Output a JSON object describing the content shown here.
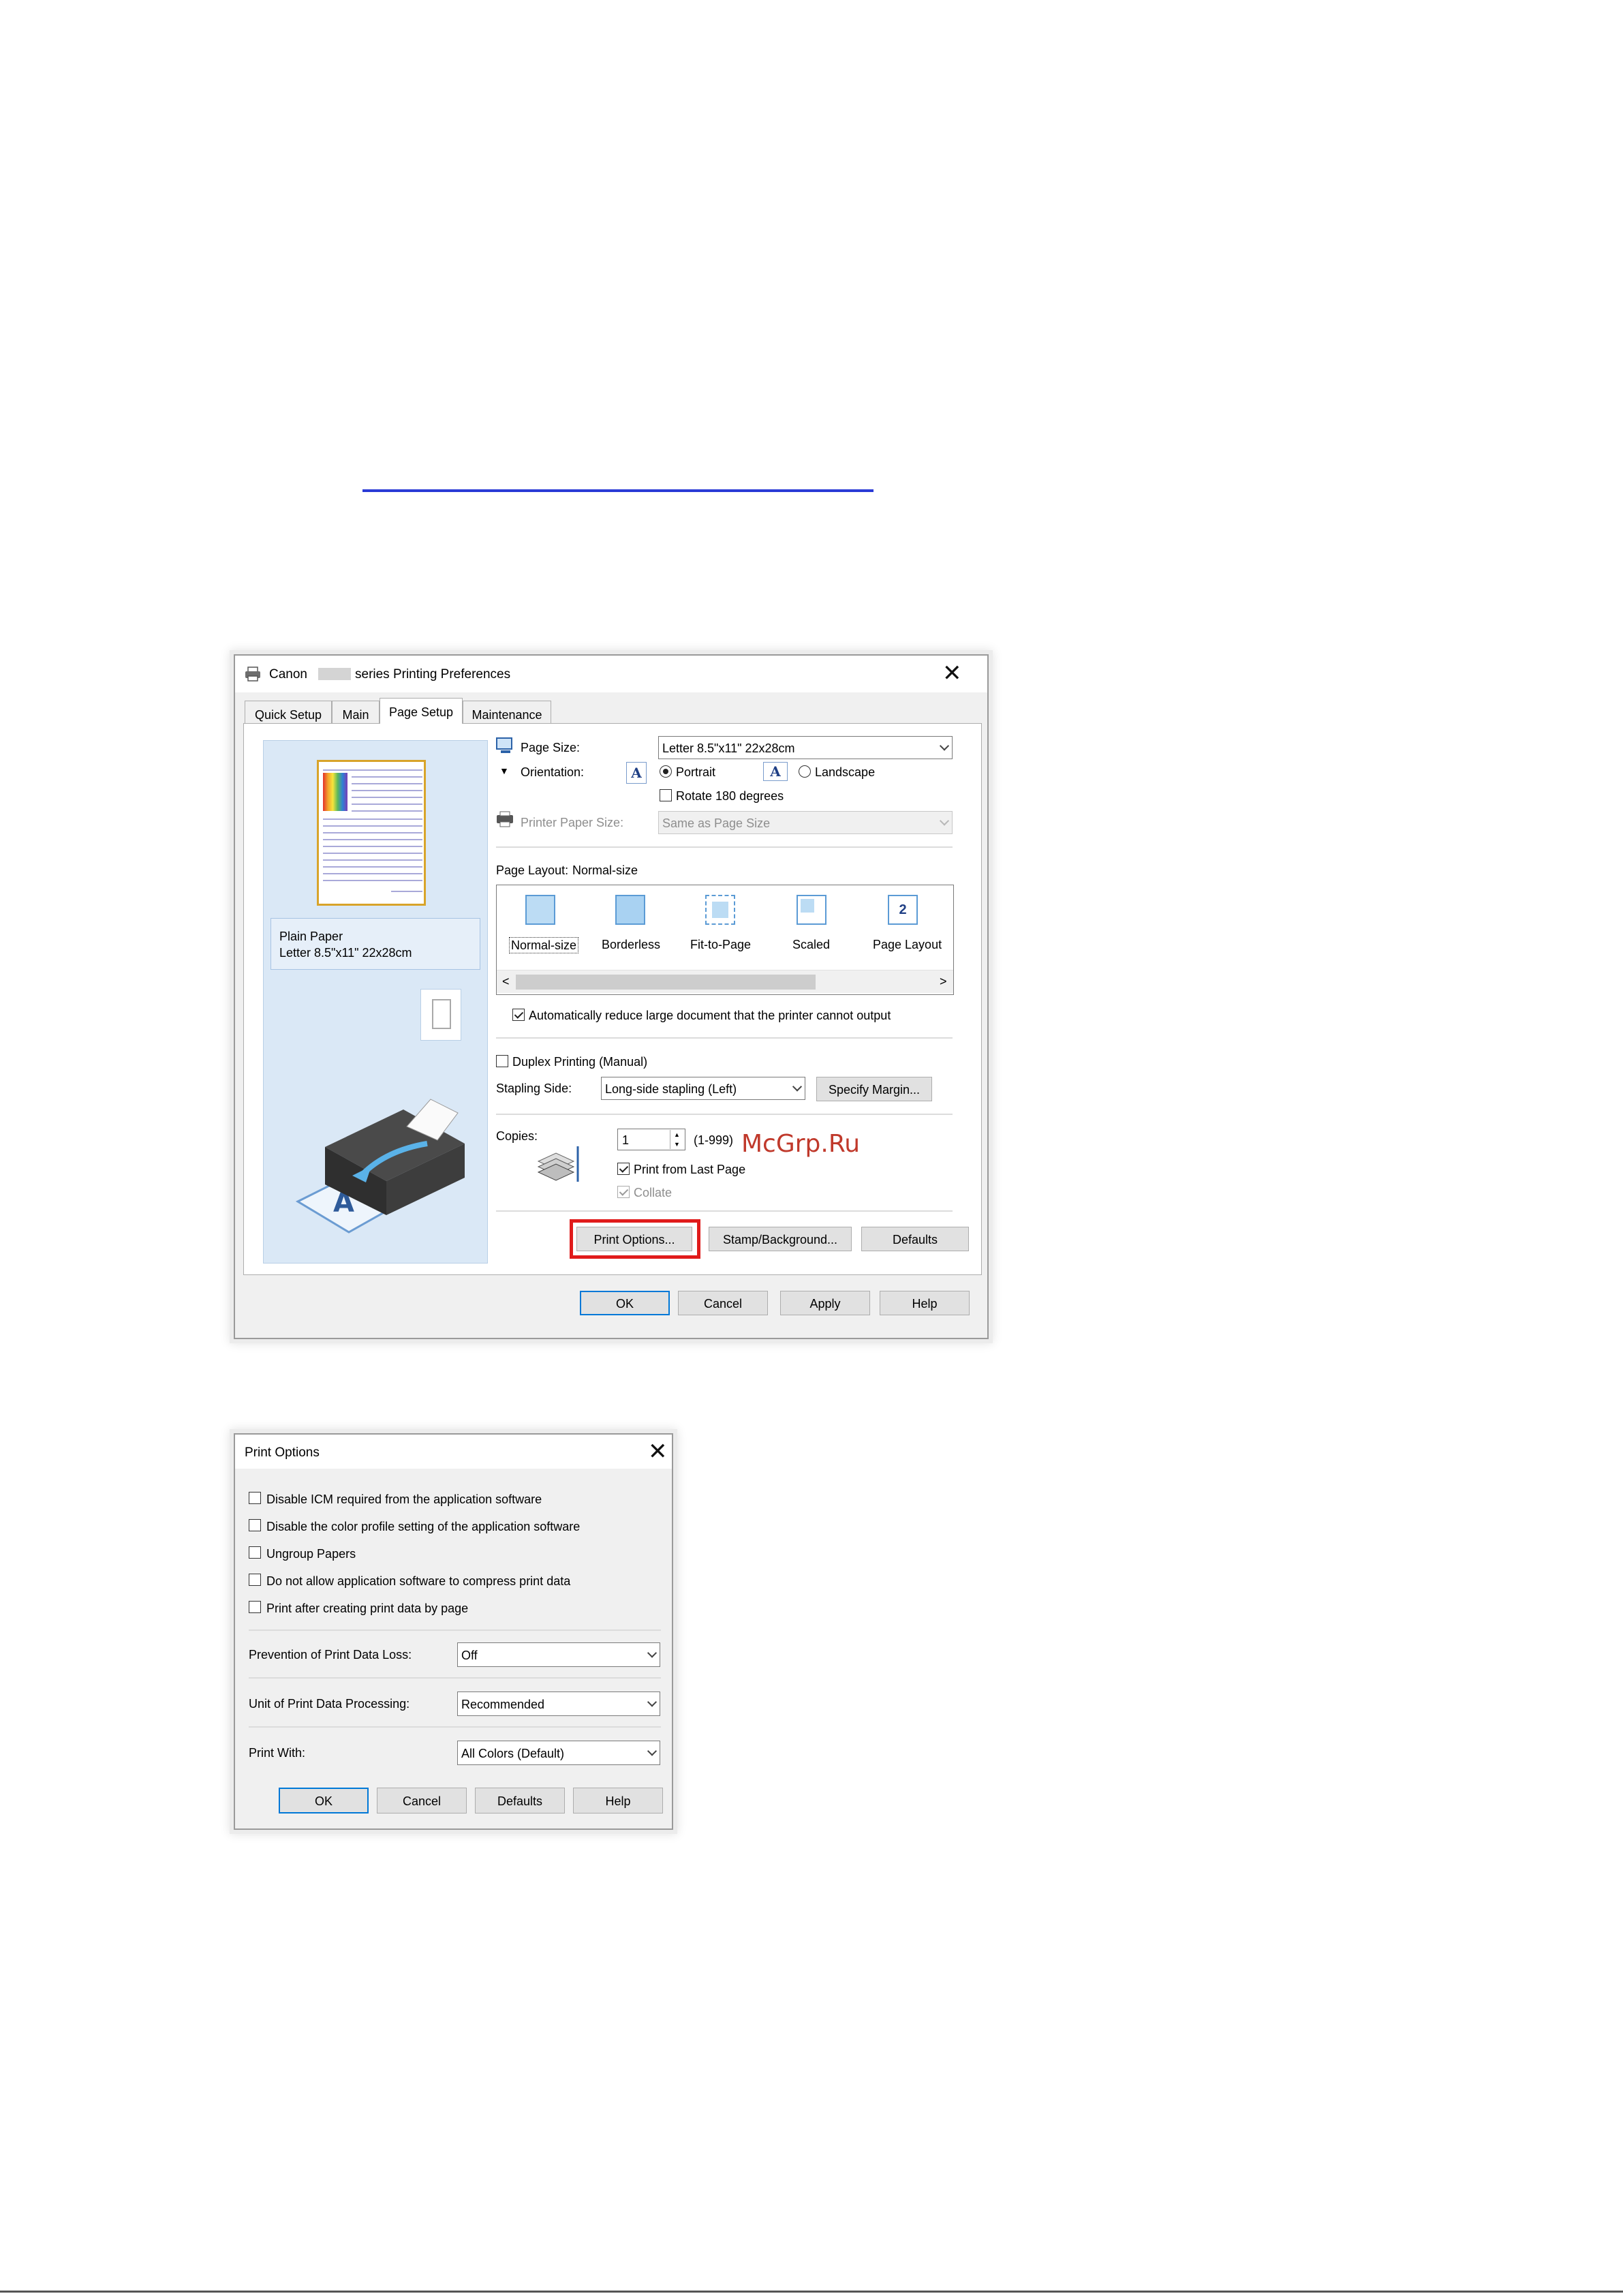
{
  "link": {
    "text": ""
  },
  "watermark": "McGrp.Ru",
  "prefs_dialog": {
    "title_left": "Canon",
    "title_right": "series Printing Preferences",
    "tabs": [
      {
        "label": "Quick Setup",
        "active": false
      },
      {
        "label": "Main",
        "active": false
      },
      {
        "label": "Page Setup",
        "active": true
      },
      {
        "label": "Maintenance",
        "active": false
      }
    ],
    "preview": {
      "media_type": "Plain Paper",
      "media_size": "Letter 8.5\"x11\" 22x28cm"
    },
    "page_size": {
      "label": "Page Size:",
      "value": "Letter 8.5\"x11\" 22x28cm"
    },
    "orientation": {
      "label": "Orientation:",
      "portrait": "Portrait",
      "landscape": "Landscape",
      "selected": "Portrait"
    },
    "rotate_180": {
      "label": "Rotate 180 degrees",
      "checked": false
    },
    "printer_paper_size": {
      "label": "Printer Paper Size:",
      "value": "Same as Page Size",
      "disabled": true
    },
    "page_layout": {
      "label": "Page Layout:",
      "value": "Normal-size",
      "items": [
        "Normal-size",
        "Borderless",
        "Fit-to-Page",
        "Scaled",
        "Page Layout"
      ]
    },
    "auto_reduce": {
      "label": "Automatically reduce large document that the printer cannot output",
      "checked": true
    },
    "duplex": {
      "label": "Duplex Printing (Manual)",
      "checked": false
    },
    "stapling_side": {
      "label": "Stapling Side:",
      "value": "Long-side stapling (Left)"
    },
    "specify_margin": "Specify Margin...",
    "copies": {
      "label": "Copies:",
      "value": "1",
      "range": "(1-999)"
    },
    "print_from_last_page": {
      "label": "Print from Last Page",
      "checked": true
    },
    "collate": {
      "label": "Collate",
      "checked": true,
      "disabled": true
    },
    "buttons": {
      "print_options": "Print Options...",
      "stamp_background": "Stamp/Background...",
      "defaults": "Defaults",
      "ok": "OK",
      "cancel": "Cancel",
      "apply": "Apply",
      "help": "Help"
    },
    "highlight_color": "#e01b1b"
  },
  "print_options_dialog": {
    "title": "Print Options",
    "checkboxes": [
      {
        "label": "Disable ICM required from the application software",
        "checked": false
      },
      {
        "label": "Disable the color profile setting of the application software",
        "checked": false
      },
      {
        "label": "Ungroup Papers",
        "checked": false
      },
      {
        "label": "Do not allow application software to compress print data",
        "checked": false
      },
      {
        "label": "Print after creating print data by page",
        "checked": false
      }
    ],
    "prevention": {
      "label": "Prevention of Print Data Loss:",
      "value": "Off"
    },
    "unit": {
      "label": "Unit of Print Data Processing:",
      "value": "Recommended"
    },
    "print_with": {
      "label": "Print With:",
      "value": "All Colors (Default)"
    },
    "buttons": {
      "ok": "OK",
      "cancel": "Cancel",
      "defaults": "Defaults",
      "help": "Help"
    }
  }
}
